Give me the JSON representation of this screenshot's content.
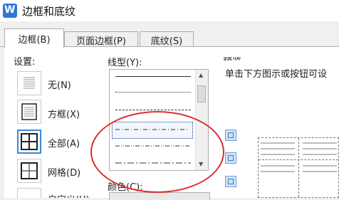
{
  "window": {
    "title": "边框和底纹",
    "app_icon": "wps-writer-icon",
    "app_icon_letter": "W"
  },
  "tabs": [
    {
      "label": "边框(B)",
      "active": true
    },
    {
      "label": "页面边框(P)",
      "active": false
    },
    {
      "label": "底纹(S)",
      "active": false
    }
  ],
  "settings": {
    "heading": "设置:",
    "items": [
      {
        "label": "无(N)",
        "icon": "none-border-icon",
        "selected": false
      },
      {
        "label": "方框(X)",
        "icon": "box-border-icon",
        "selected": false
      },
      {
        "label": "全部(A)",
        "icon": "all-border-icon",
        "selected": true
      },
      {
        "label": "网格(D)",
        "icon": "grid-border-icon",
        "selected": false
      },
      {
        "label": "自定义(U)",
        "icon": "custom-border-icon",
        "selected": false
      }
    ]
  },
  "line_style": {
    "heading": "线型(Y):",
    "styles": [
      "solid",
      "dotted",
      "dashed",
      "dash-dot",
      "dash-dot-dot",
      "long-dash-dot"
    ],
    "selected_index": 3
  },
  "color": {
    "heading": "颜色(C):"
  },
  "preview": {
    "heading": "预览",
    "hint": "单击下方图示或按钮可设"
  },
  "annotation": {
    "color": "#dd2e2e"
  }
}
